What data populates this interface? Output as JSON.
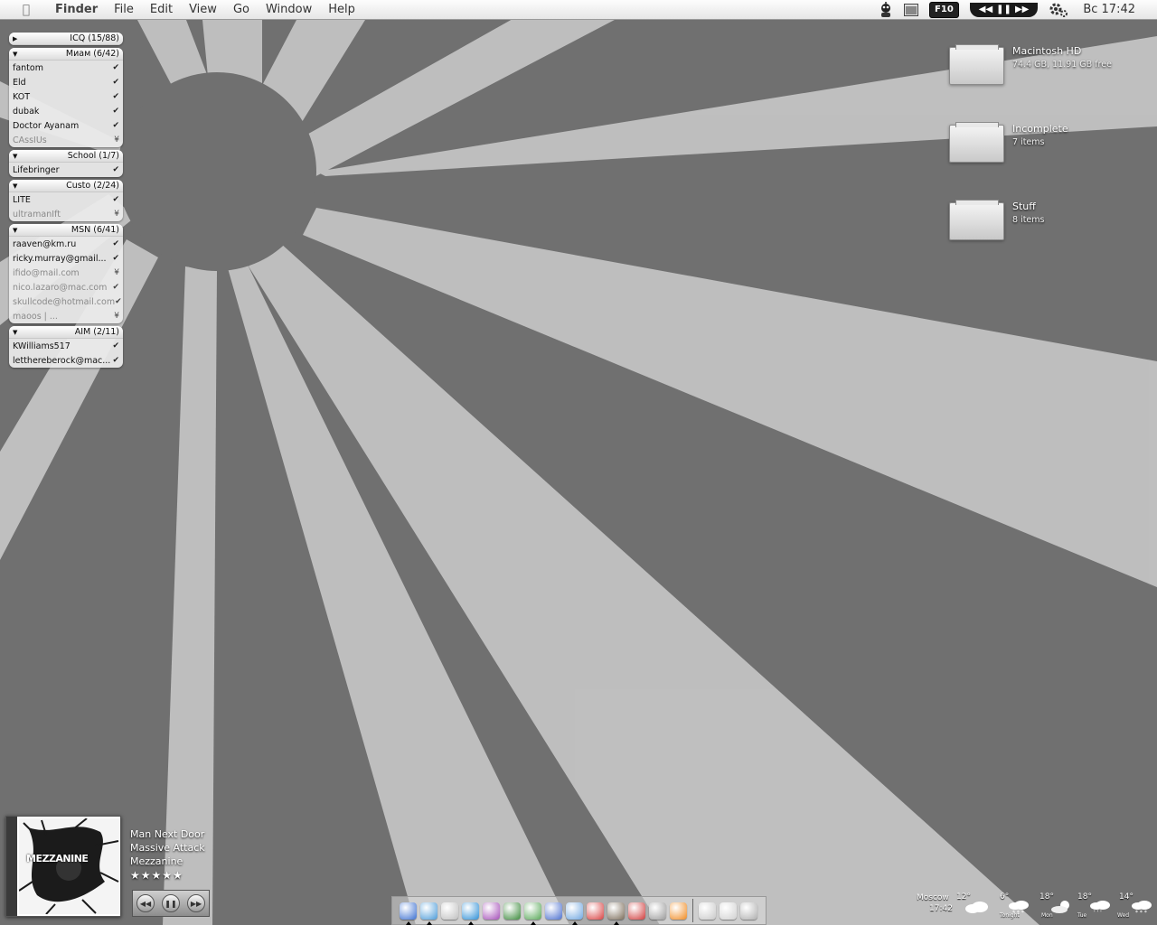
{
  "menubar": {
    "apple_icon": "apple-icon",
    "items": [
      "Finder",
      "File",
      "Edit",
      "View",
      "Go",
      "Window",
      "Help"
    ],
    "f10_label": "F10",
    "clock": "Вс 17:42"
  },
  "buddylist": {
    "groups": [
      {
        "name": "ICQ (15/88)",
        "expanded": false,
        "contacts": []
      },
      {
        "name": "Миам (6/42)",
        "expanded": true,
        "contacts": [
          {
            "name": "fantom",
            "status": "online"
          },
          {
            "name": "Eld",
            "status": "online"
          },
          {
            "name": "KOT",
            "status": "online"
          },
          {
            "name": "dubak",
            "status": "online"
          },
          {
            "name": "Doctor Ayanam",
            "status": "online"
          },
          {
            "name": "CAssIUs",
            "status": "away"
          }
        ]
      },
      {
        "name": "School (1/7)",
        "expanded": true,
        "contacts": [
          {
            "name": "Lifebringer",
            "status": "online"
          }
        ]
      },
      {
        "name": "Custo (2/24)",
        "expanded": true,
        "contacts": [
          {
            "name": "LITE",
            "status": "online"
          },
          {
            "name": "ultramanIft",
            "status": "away"
          }
        ]
      },
      {
        "name": "MSN (6/41)",
        "expanded": true,
        "contacts": [
          {
            "name": "raaven@km.ru",
            "status": "online"
          },
          {
            "name": "ricky.murray@gmail...",
            "status": "online"
          },
          {
            "name": "ifido@mail.com",
            "status": "away"
          },
          {
            "name": "nico.lazaro@mac.com",
            "status": "away"
          },
          {
            "name": "skullcode@hotmail.com",
            "status": "away"
          },
          {
            "name": "maoos | ...",
            "status": "away"
          }
        ]
      },
      {
        "name": "AIM (2/11)",
        "expanded": true,
        "contacts": [
          {
            "name": "KWilliams517",
            "status": "online"
          },
          {
            "name": "letthereberock@mac...",
            "status": "online"
          }
        ]
      }
    ]
  },
  "desktop": {
    "drives": [
      {
        "name": "Macintosh HD",
        "info": "74.4 GB, 11.91 GB free"
      },
      {
        "name": "Incomplete",
        "info": "7 items"
      },
      {
        "name": "Stuff",
        "info": "8 items"
      }
    ]
  },
  "nowplaying": {
    "album_art_text": "MEZZANINE",
    "track": "Man Next Door",
    "artist": "Massive Attack",
    "album": "Mezzanine",
    "rating": "★★★★★",
    "controls": [
      "rewind-icon",
      "pause-icon",
      "fast-forward-icon"
    ]
  },
  "dock": {
    "icons": [
      {
        "name": "rocket-icon",
        "color": "#3b6fd1",
        "running": true
      },
      {
        "name": "safari-icon",
        "color": "#4a9ad8",
        "running": true
      },
      {
        "name": "mail-icon",
        "color": "#bfbfbf",
        "running": false
      },
      {
        "name": "adium-icon",
        "color": "#2e8fd6",
        "running": true
      },
      {
        "name": "orb-icon",
        "color": "#a44db8",
        "running": false
      },
      {
        "name": "tree-icon",
        "color": "#3a8a3a",
        "running": false
      },
      {
        "name": "itunes-icon",
        "color": "#58a858",
        "running": true
      },
      {
        "name": "pen-icon",
        "color": "#4b6fcf",
        "running": false
      },
      {
        "name": "preview-icon",
        "color": "#6fa6e0",
        "running": true
      },
      {
        "name": "red-app-icon",
        "color": "#d84040",
        "running": false
      },
      {
        "name": "photo-icon",
        "color": "#7a6b58",
        "running": true
      },
      {
        "name": "calendar-icon",
        "color": "#d03a3a",
        "running": false
      },
      {
        "name": "disk-utility-icon",
        "color": "#9a9a9a",
        "running": false
      },
      {
        "name": "vlc-icon",
        "color": "#f08a20",
        "running": false
      },
      {
        "name": "minimized-window-icon",
        "color": "#c8c8c8",
        "running": false
      },
      {
        "name": "minimized-window-2-icon",
        "color": "#d0d0d0",
        "running": false
      },
      {
        "name": "trash-icon",
        "color": "#aeaeae",
        "running": false
      }
    ],
    "separator_after": 13
  },
  "weather": {
    "city": "Moscow",
    "time": "17:42",
    "current_temp": "12°",
    "forecast": [
      {
        "temp": "6°",
        "day": "Tonight"
      },
      {
        "temp": "18°",
        "day": "Mon"
      },
      {
        "temp": "18°",
        "day": "Tue"
      },
      {
        "temp": "14°",
        "day": "Wed"
      }
    ]
  }
}
